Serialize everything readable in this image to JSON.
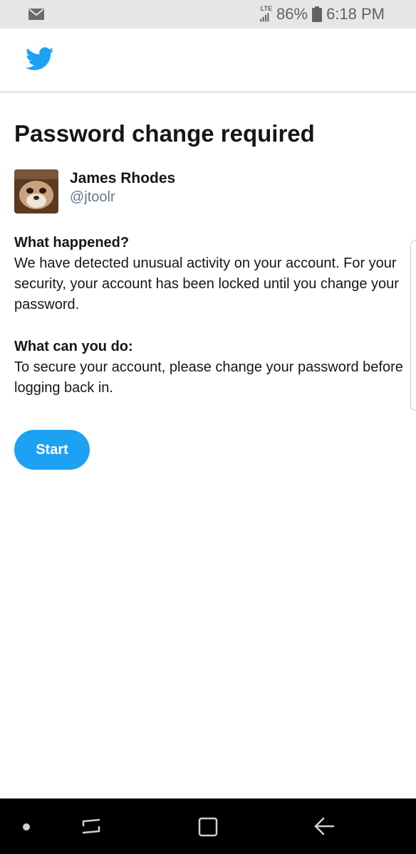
{
  "status_bar": {
    "network": "LTE",
    "battery": "86%",
    "time": "6:18 PM"
  },
  "header": {
    "logo": "twitter-bird-icon",
    "brand_color": "#1da1f2"
  },
  "page": {
    "title": "Password change required"
  },
  "profile": {
    "name": "James Rhodes",
    "handle": "@jtoolr"
  },
  "sections": [
    {
      "heading": "What happened?",
      "body": "We have detected unusual activity on your account. For your security, your account has been locked until you change your password."
    },
    {
      "heading": "What can you do:",
      "body": "To secure your account, please change your password before logging back in."
    }
  ],
  "actions": {
    "start_label": "Start"
  },
  "nav_bar": {
    "icons": [
      "home-dot-icon",
      "recent-apps-icon",
      "home-icon",
      "back-icon"
    ]
  }
}
